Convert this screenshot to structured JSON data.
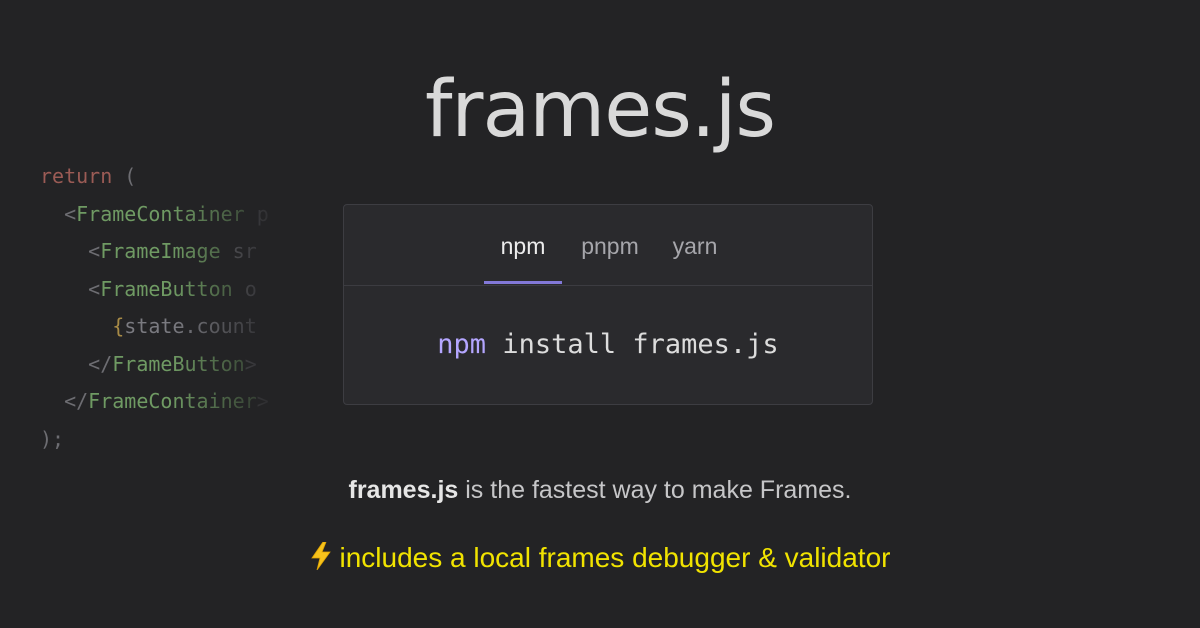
{
  "header": {
    "title": "frames.js"
  },
  "code_snippet": {
    "lines": [
      [
        {
          "t": "kw",
          "v": "return"
        },
        {
          "t": "pn",
          "v": " ("
        }
      ],
      [
        {
          "t": "pn",
          "v": "  <"
        },
        {
          "t": "tg",
          "v": "FrameContainer"
        },
        {
          "t": "at",
          "v": " p"
        }
      ],
      [
        {
          "t": "pn",
          "v": "    <"
        },
        {
          "t": "tg",
          "v": "FrameImage"
        },
        {
          "t": "at",
          "v": " sr"
        }
      ],
      [
        {
          "t": "pn",
          "v": "    <"
        },
        {
          "t": "tg",
          "v": "FrameButton"
        },
        {
          "t": "at",
          "v": " o"
        }
      ],
      [
        {
          "t": "pn",
          "v": "      "
        },
        {
          "t": "br",
          "v": "{"
        },
        {
          "t": "at",
          "v": "state.count"
        }
      ],
      [
        {
          "t": "pn",
          "v": "    </"
        },
        {
          "t": "tg",
          "v": "FrameButton"
        },
        {
          "t": "pn",
          "v": ">"
        }
      ],
      [
        {
          "t": "pn",
          "v": "  </"
        },
        {
          "t": "tg",
          "v": "FrameContainer"
        },
        {
          "t": "pn",
          "v": ">"
        }
      ],
      [
        {
          "t": "pn",
          "v": ");"
        }
      ]
    ]
  },
  "installer": {
    "tabs": [
      {
        "label": "npm",
        "active": true
      },
      {
        "label": "pnpm",
        "active": false
      },
      {
        "label": "yarn",
        "active": false
      }
    ],
    "command_manager": "npm",
    "command_rest": " install frames.js",
    "accent_color": "#8278d8"
  },
  "tagline": {
    "bold": "frames.js",
    "rest": " is the fastest way to make Frames."
  },
  "feature": {
    "icon": "lightning-bolt-icon",
    "text": "includes a local frames debugger & validator",
    "color": "#f1e300"
  }
}
